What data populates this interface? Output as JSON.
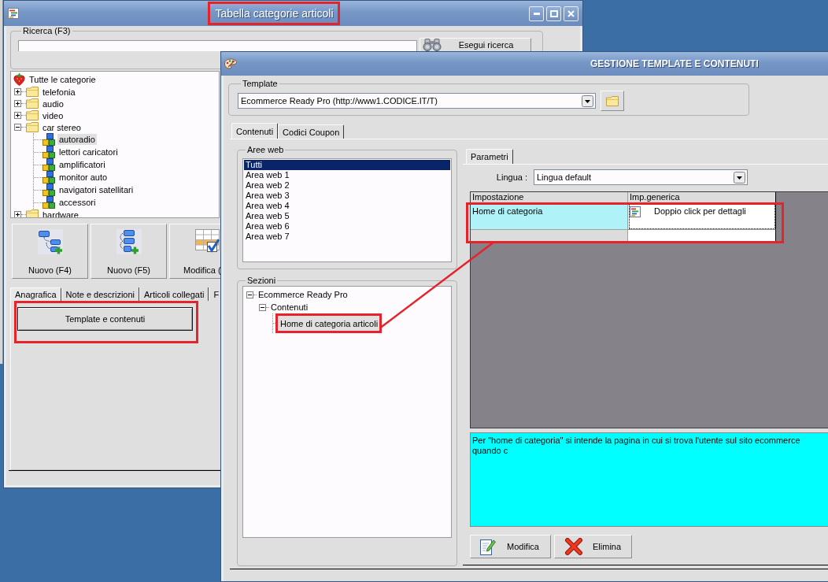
{
  "category_window": {
    "title": "Tabella categorie articoli",
    "title_highlighted": true,
    "search": {
      "legend": "Ricerca (F3)",
      "button": "Esegui ricerca"
    },
    "tree": [
      {
        "label": "Tutte le categorie",
        "kind": "root",
        "selected": false,
        "children": [
          {
            "label": "telefonia",
            "kind": "folder",
            "expanded": false,
            "selected": false
          },
          {
            "label": "audio",
            "kind": "folder",
            "expanded": false,
            "selected": false
          },
          {
            "label": "video",
            "kind": "folder",
            "expanded": false,
            "selected": false
          },
          {
            "label": "car stereo",
            "kind": "folder",
            "expanded": true,
            "selected": false,
            "children": [
              {
                "label": "autoradio",
                "kind": "category",
                "selected": true
              },
              {
                "label": "lettori caricatori",
                "kind": "category",
                "selected": false
              },
              {
                "label": "amplificatori",
                "kind": "category",
                "selected": false
              },
              {
                "label": "monitor auto",
                "kind": "category",
                "selected": false
              },
              {
                "label": "navigatori satellitari",
                "kind": "category",
                "selected": false
              },
              {
                "label": "accessori",
                "kind": "category",
                "selected": false
              }
            ]
          },
          {
            "label": "hardware",
            "kind": "folder",
            "expanded": false,
            "selected": false
          }
        ]
      }
    ],
    "toolbar": [
      {
        "label": "Nuovo (F4)",
        "kind": "add_child"
      },
      {
        "label": "Nuovo (F5)",
        "kind": "add_sibling"
      },
      {
        "label": "Modifica (",
        "kind": "edit"
      }
    ],
    "tabs": [
      {
        "label": "Anagrafica",
        "selected": true
      },
      {
        "label": "Note e descrizioni",
        "selected": false
      },
      {
        "label": "Articoli collegati",
        "selected": false
      },
      {
        "label": "F",
        "selected": false
      }
    ],
    "panel_button": {
      "label": "Template e contenuti",
      "highlighted": true
    }
  },
  "template_window": {
    "title": "GESTIONE TEMPLATE E CONTENUTI",
    "template": {
      "legend": "Template",
      "value": "Ecommerce Ready Pro (http://www1.CODICE.IT/T)"
    },
    "tabs": [
      {
        "label": "Contenuti",
        "selected": true
      },
      {
        "label": "Codici Coupon",
        "selected": false
      }
    ],
    "web_areas": {
      "legend": "Aree web",
      "items": [
        {
          "label": "Tutti",
          "selected": true
        },
        {
          "label": "Area web 1",
          "selected": false
        },
        {
          "label": "Area web 2",
          "selected": false
        },
        {
          "label": "Area web 3",
          "selected": false
        },
        {
          "label": "Area web 4",
          "selected": false
        },
        {
          "label": "Area web 5",
          "selected": false
        },
        {
          "label": "Area web 6",
          "selected": false
        },
        {
          "label": "Area web 7",
          "selected": false
        }
      ]
    },
    "sections": {
      "legend": "Sezioni",
      "tree": [
        {
          "label": "Ecommerce Ready Pro",
          "expanded": true,
          "selected": false,
          "children": [
            {
              "label": "Contenuti",
              "expanded": true,
              "selected": false,
              "children": [
                {
                  "label": "Home di categoria articoli",
                  "selected": true,
                  "highlighted": true
                }
              ]
            }
          ]
        }
      ]
    },
    "parameter_tabs": [
      {
        "label": "Parametri",
        "selected": true
      }
    ],
    "language": {
      "label": "Lingua :",
      "value": "Lingua default"
    },
    "grid": {
      "columns": [
        "Impostazione",
        "Imp.generica"
      ],
      "highlighted": true,
      "rows": [
        {
          "selected": true,
          "cells": [
            "Home di categoria",
            "Doppio click per dettagli"
          ]
        }
      ]
    },
    "description": "Per \"home di categoria\" si intende la pagina in cui si trova l'utente sul sito ecommerce quando c",
    "buttons": [
      {
        "label": "Modifica",
        "kind": "edit"
      },
      {
        "label": "Elimina",
        "kind": "delete"
      }
    ],
    "callout_line": true
  }
}
